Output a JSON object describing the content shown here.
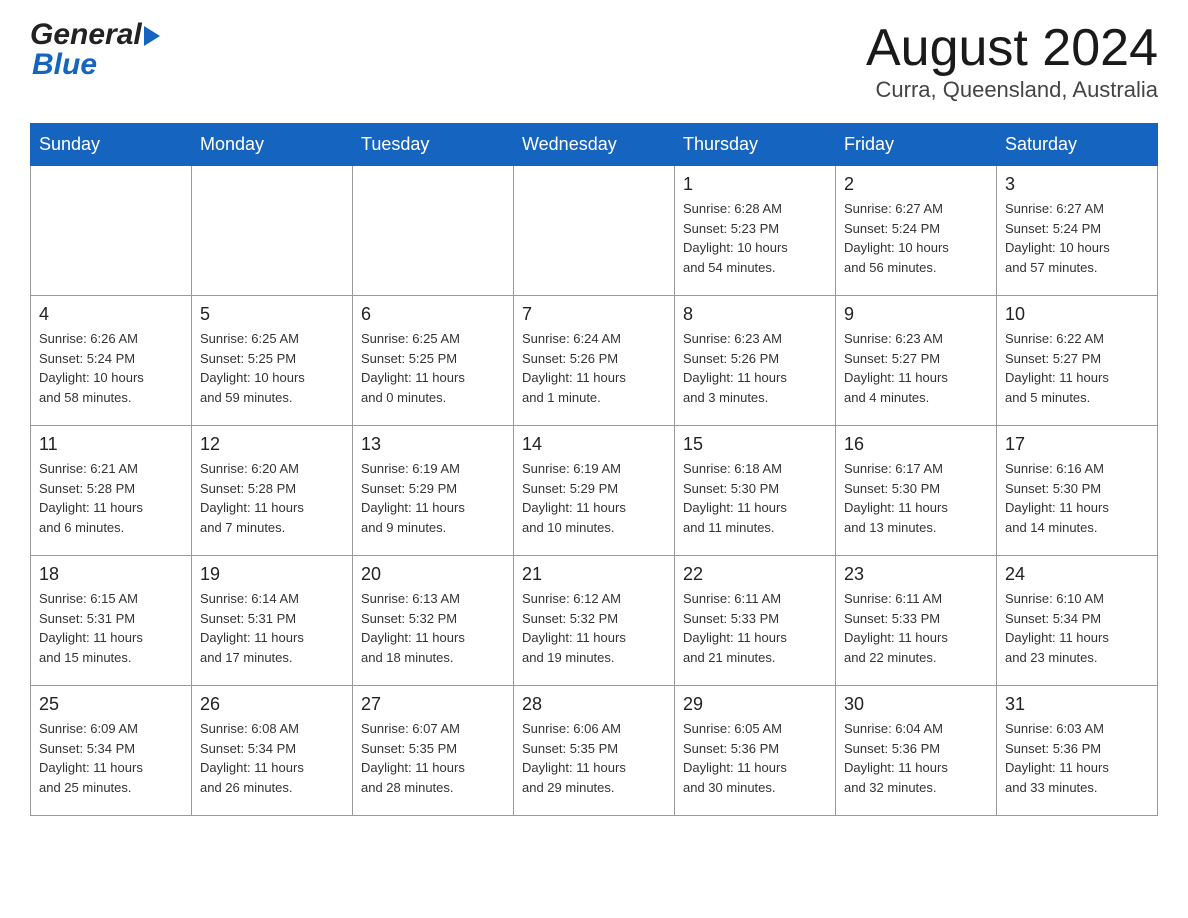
{
  "header": {
    "logo_general": "General",
    "logo_blue": "Blue",
    "month_title": "August 2024",
    "location": "Curra, Queensland, Australia"
  },
  "days_of_week": [
    "Sunday",
    "Monday",
    "Tuesday",
    "Wednesday",
    "Thursday",
    "Friday",
    "Saturday"
  ],
  "weeks": [
    [
      {
        "day": "",
        "info": ""
      },
      {
        "day": "",
        "info": ""
      },
      {
        "day": "",
        "info": ""
      },
      {
        "day": "",
        "info": ""
      },
      {
        "day": "1",
        "info": "Sunrise: 6:28 AM\nSunset: 5:23 PM\nDaylight: 10 hours\nand 54 minutes."
      },
      {
        "day": "2",
        "info": "Sunrise: 6:27 AM\nSunset: 5:24 PM\nDaylight: 10 hours\nand 56 minutes."
      },
      {
        "day": "3",
        "info": "Sunrise: 6:27 AM\nSunset: 5:24 PM\nDaylight: 10 hours\nand 57 minutes."
      }
    ],
    [
      {
        "day": "4",
        "info": "Sunrise: 6:26 AM\nSunset: 5:24 PM\nDaylight: 10 hours\nand 58 minutes."
      },
      {
        "day": "5",
        "info": "Sunrise: 6:25 AM\nSunset: 5:25 PM\nDaylight: 10 hours\nand 59 minutes."
      },
      {
        "day": "6",
        "info": "Sunrise: 6:25 AM\nSunset: 5:25 PM\nDaylight: 11 hours\nand 0 minutes."
      },
      {
        "day": "7",
        "info": "Sunrise: 6:24 AM\nSunset: 5:26 PM\nDaylight: 11 hours\nand 1 minute."
      },
      {
        "day": "8",
        "info": "Sunrise: 6:23 AM\nSunset: 5:26 PM\nDaylight: 11 hours\nand 3 minutes."
      },
      {
        "day": "9",
        "info": "Sunrise: 6:23 AM\nSunset: 5:27 PM\nDaylight: 11 hours\nand 4 minutes."
      },
      {
        "day": "10",
        "info": "Sunrise: 6:22 AM\nSunset: 5:27 PM\nDaylight: 11 hours\nand 5 minutes."
      }
    ],
    [
      {
        "day": "11",
        "info": "Sunrise: 6:21 AM\nSunset: 5:28 PM\nDaylight: 11 hours\nand 6 minutes."
      },
      {
        "day": "12",
        "info": "Sunrise: 6:20 AM\nSunset: 5:28 PM\nDaylight: 11 hours\nand 7 minutes."
      },
      {
        "day": "13",
        "info": "Sunrise: 6:19 AM\nSunset: 5:29 PM\nDaylight: 11 hours\nand 9 minutes."
      },
      {
        "day": "14",
        "info": "Sunrise: 6:19 AM\nSunset: 5:29 PM\nDaylight: 11 hours\nand 10 minutes."
      },
      {
        "day": "15",
        "info": "Sunrise: 6:18 AM\nSunset: 5:30 PM\nDaylight: 11 hours\nand 11 minutes."
      },
      {
        "day": "16",
        "info": "Sunrise: 6:17 AM\nSunset: 5:30 PM\nDaylight: 11 hours\nand 13 minutes."
      },
      {
        "day": "17",
        "info": "Sunrise: 6:16 AM\nSunset: 5:30 PM\nDaylight: 11 hours\nand 14 minutes."
      }
    ],
    [
      {
        "day": "18",
        "info": "Sunrise: 6:15 AM\nSunset: 5:31 PM\nDaylight: 11 hours\nand 15 minutes."
      },
      {
        "day": "19",
        "info": "Sunrise: 6:14 AM\nSunset: 5:31 PM\nDaylight: 11 hours\nand 17 minutes."
      },
      {
        "day": "20",
        "info": "Sunrise: 6:13 AM\nSunset: 5:32 PM\nDaylight: 11 hours\nand 18 minutes."
      },
      {
        "day": "21",
        "info": "Sunrise: 6:12 AM\nSunset: 5:32 PM\nDaylight: 11 hours\nand 19 minutes."
      },
      {
        "day": "22",
        "info": "Sunrise: 6:11 AM\nSunset: 5:33 PM\nDaylight: 11 hours\nand 21 minutes."
      },
      {
        "day": "23",
        "info": "Sunrise: 6:11 AM\nSunset: 5:33 PM\nDaylight: 11 hours\nand 22 minutes."
      },
      {
        "day": "24",
        "info": "Sunrise: 6:10 AM\nSunset: 5:34 PM\nDaylight: 11 hours\nand 23 minutes."
      }
    ],
    [
      {
        "day": "25",
        "info": "Sunrise: 6:09 AM\nSunset: 5:34 PM\nDaylight: 11 hours\nand 25 minutes."
      },
      {
        "day": "26",
        "info": "Sunrise: 6:08 AM\nSunset: 5:34 PM\nDaylight: 11 hours\nand 26 minutes."
      },
      {
        "day": "27",
        "info": "Sunrise: 6:07 AM\nSunset: 5:35 PM\nDaylight: 11 hours\nand 28 minutes."
      },
      {
        "day": "28",
        "info": "Sunrise: 6:06 AM\nSunset: 5:35 PM\nDaylight: 11 hours\nand 29 minutes."
      },
      {
        "day": "29",
        "info": "Sunrise: 6:05 AM\nSunset: 5:36 PM\nDaylight: 11 hours\nand 30 minutes."
      },
      {
        "day": "30",
        "info": "Sunrise: 6:04 AM\nSunset: 5:36 PM\nDaylight: 11 hours\nand 32 minutes."
      },
      {
        "day": "31",
        "info": "Sunrise: 6:03 AM\nSunset: 5:36 PM\nDaylight: 11 hours\nand 33 minutes."
      }
    ]
  ],
  "colors": {
    "header_bg": "#1565c0",
    "header_text": "#ffffff",
    "border": "#999999"
  }
}
